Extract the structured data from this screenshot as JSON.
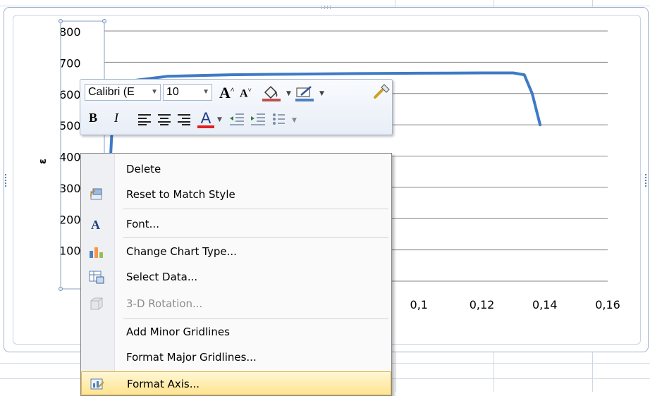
{
  "chart_data": {
    "type": "line",
    "ylabel": "ε",
    "y_ticks": [
      "800",
      "700",
      "600",
      "500",
      "400",
      "300",
      "200",
      "100"
    ],
    "x_ticks": [
      "0,1",
      "0,12",
      "0,14",
      "0,16"
    ],
    "ylim": [
      0,
      800
    ],
    "xlim": [
      0,
      0.16
    ],
    "grid": "horizontal",
    "series": [
      {
        "x": [
          0.0,
          0.003,
          0.008,
          0.02,
          0.04,
          0.06,
          0.08,
          0.1,
          0.12,
          0.13,
          0.1335,
          0.136,
          0.1385
        ],
        "y": [
          0,
          600,
          640,
          655,
          660,
          662,
          664,
          665,
          666,
          666,
          660,
          600,
          500
        ]
      }
    ],
    "color": "#3f7ac5"
  },
  "mini_toolbar": {
    "font_name": "Calibri (E",
    "font_size": "10",
    "grow_font": "A",
    "shrink_font": "A",
    "bold": "B",
    "italic": "I",
    "font_color_glyph": "A"
  },
  "context_menu": {
    "items": [
      {
        "label": "Delete",
        "icon": "none",
        "enabled": true
      },
      {
        "label": "Reset to Match Style",
        "icon": "reset-style-icon",
        "enabled": true
      },
      {
        "label": "Font...",
        "icon": "font-icon",
        "enabled": true
      },
      {
        "label": "Change Chart Type...",
        "icon": "chart-type-icon",
        "enabled": true
      },
      {
        "label": "Select Data...",
        "icon": "select-data-icon",
        "enabled": true
      },
      {
        "label": "3-D Rotation...",
        "icon": "3d-rotation-icon",
        "enabled": false
      },
      {
        "label": "Add Minor Gridlines",
        "icon": "none",
        "enabled": true
      },
      {
        "label": "Format Major Gridlines...",
        "icon": "none",
        "enabled": true
      },
      {
        "label": "Format Axis...",
        "icon": "format-axis-icon",
        "enabled": true,
        "highlighted": true
      }
    ]
  },
  "colors": {
    "menu_highlight": "#ffe48f",
    "series_line": "#3f7ac5",
    "gridline": "#868686"
  }
}
